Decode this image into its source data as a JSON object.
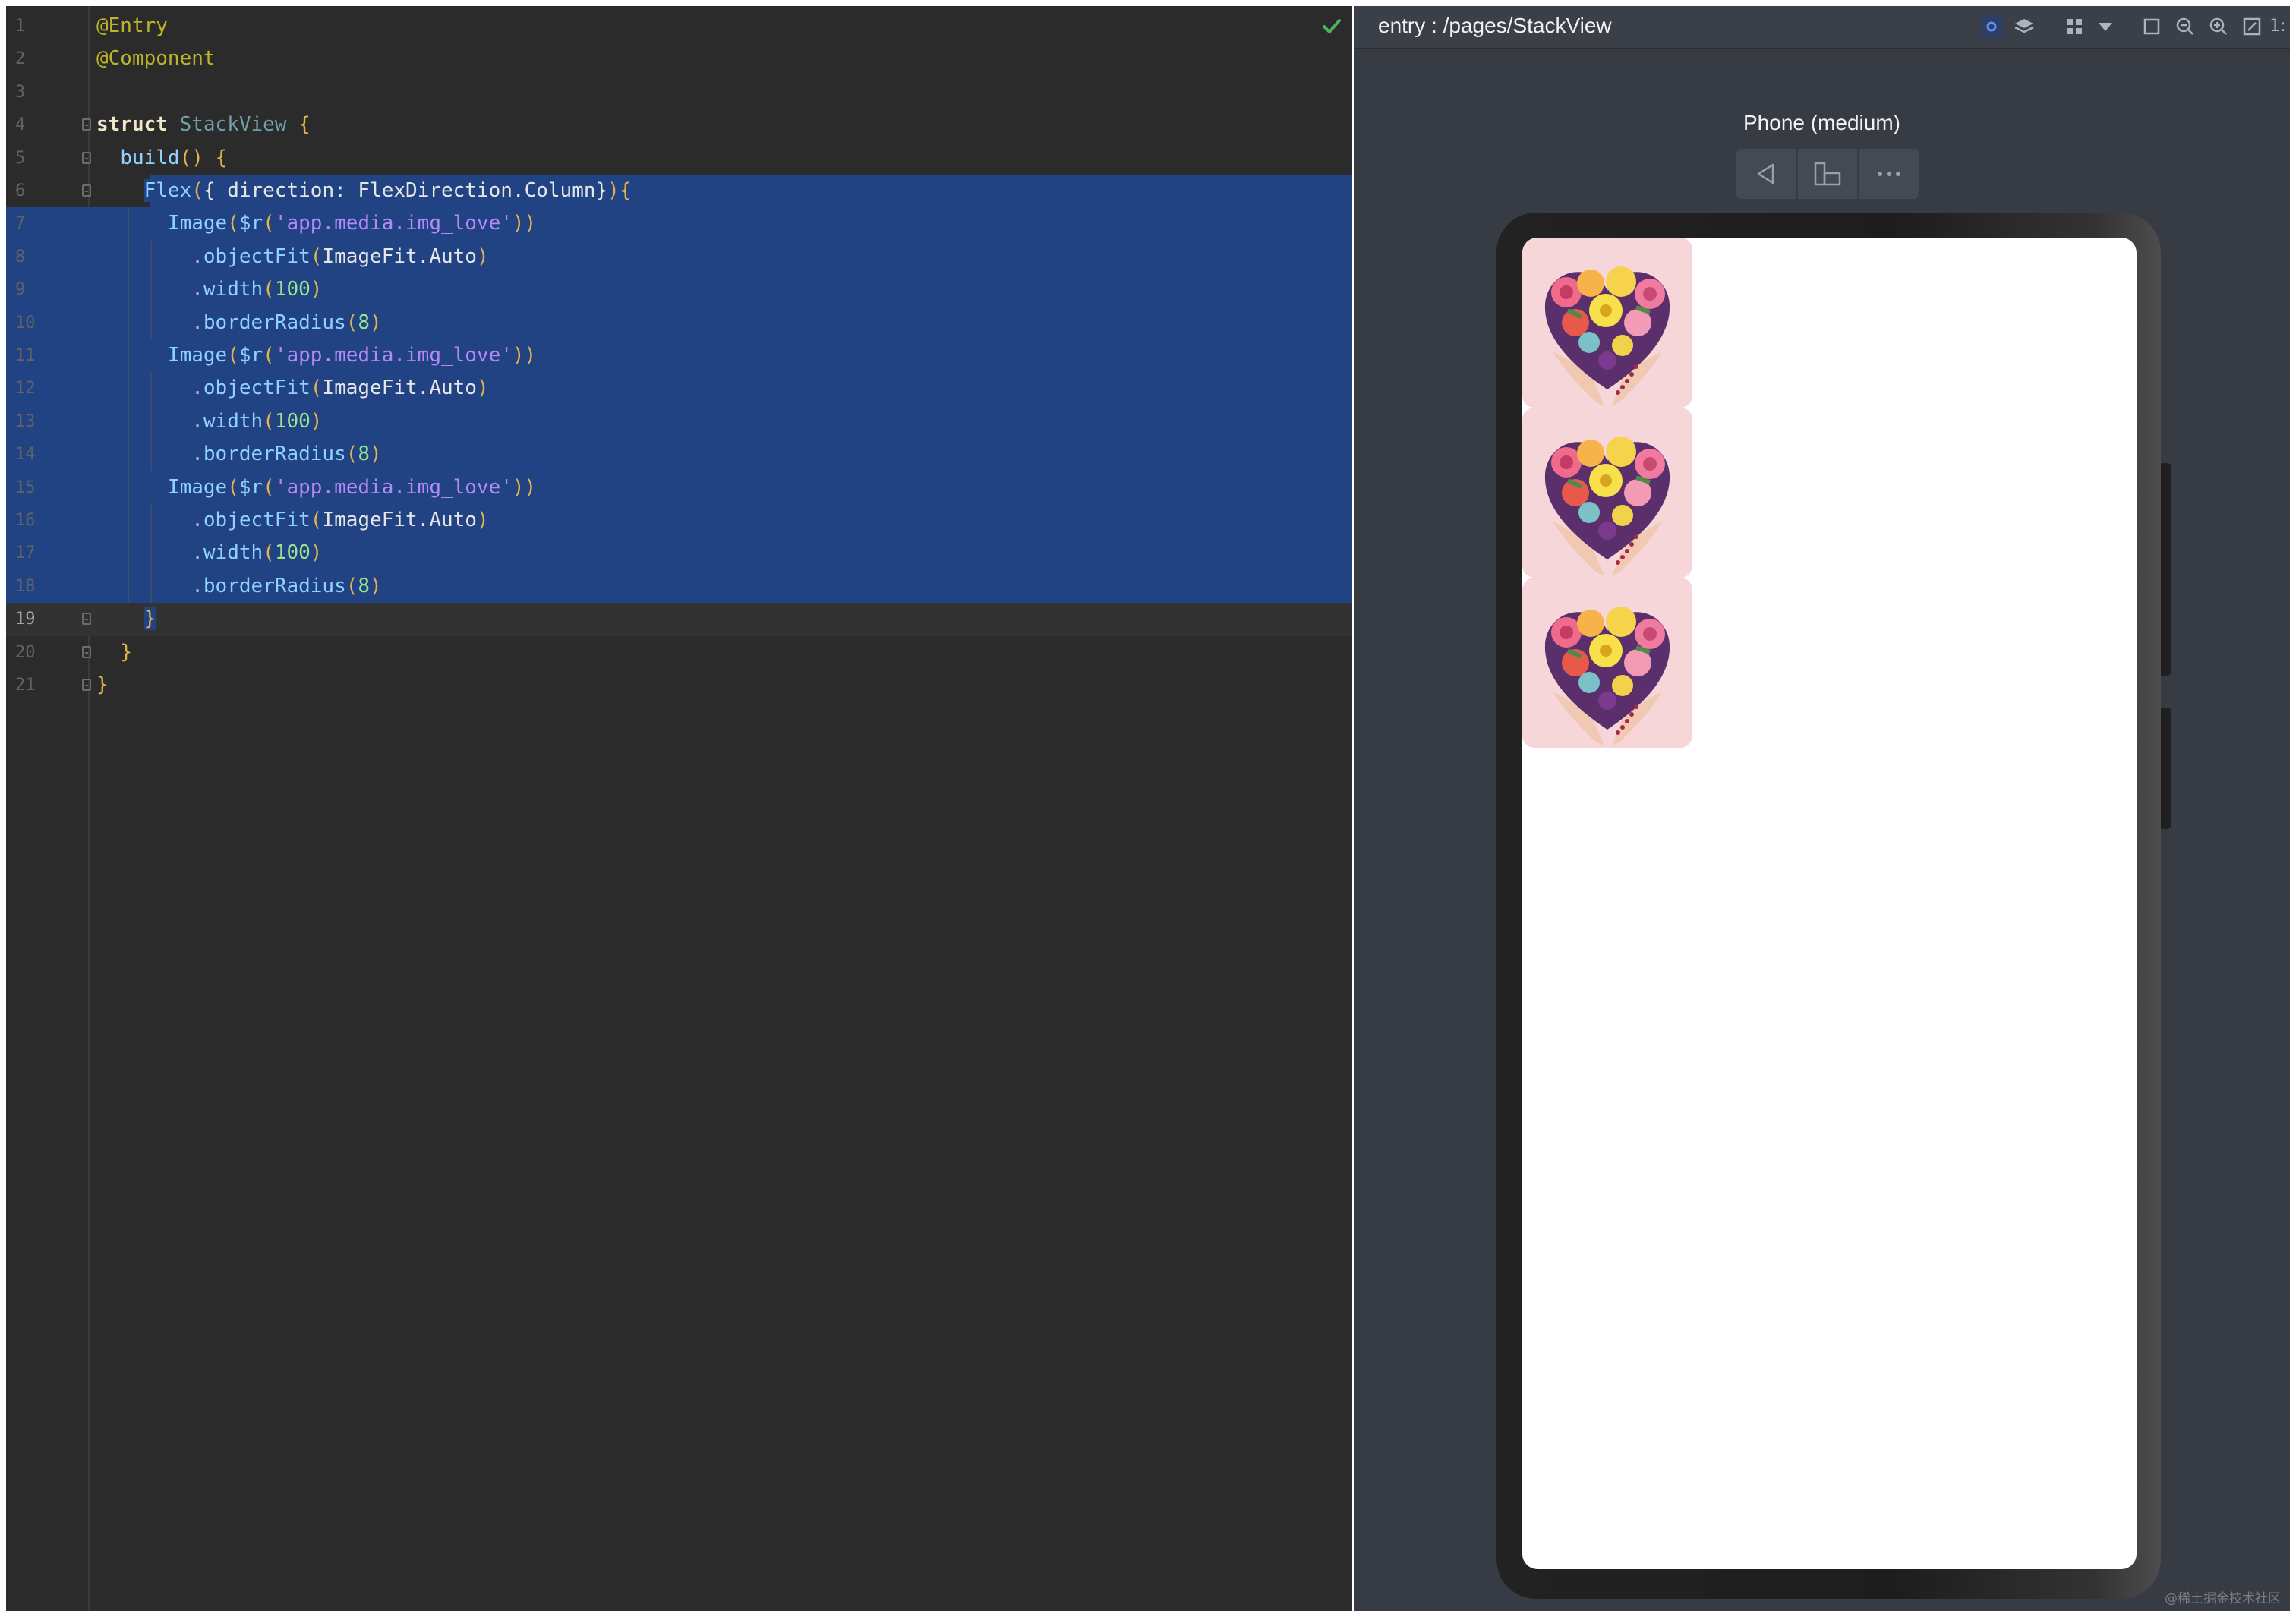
{
  "editor": {
    "lines": [
      {
        "no": "1",
        "html": [
          [
            "anno",
            "@Entry"
          ]
        ]
      },
      {
        "no": "2",
        "html": [
          [
            "anno",
            "@Component"
          ]
        ]
      },
      {
        "no": "3",
        "html": []
      },
      {
        "no": "4",
        "html": [
          [
            "kw",
            "struct"
          ],
          [
            "plain",
            " "
          ],
          [
            "type",
            "StackView"
          ],
          [
            "plain",
            " "
          ],
          [
            "brace",
            "{"
          ]
        ]
      },
      {
        "no": "5",
        "html": [
          [
            "plain",
            "  "
          ],
          [
            "fn",
            "build"
          ],
          [
            "brace",
            "()"
          ],
          [
            "plain",
            " "
          ],
          [
            "brace",
            "{"
          ]
        ]
      },
      {
        "no": "6",
        "html": [
          [
            "plain",
            "    "
          ],
          [
            "fn",
            "Flex"
          ],
          [
            "brace",
            "("
          ],
          [
            "punc",
            "{ "
          ],
          [
            "id",
            "direction"
          ],
          [
            "punc",
            ": "
          ],
          [
            "id",
            "FlexDirection"
          ],
          [
            "punc",
            "."
          ],
          [
            "id",
            "Column"
          ],
          [
            "punc",
            "}"
          ],
          [
            "brace",
            ")"
          ],
          [
            "brace",
            "{"
          ]
        ]
      },
      {
        "no": "7",
        "html": [
          [
            "plain",
            "      "
          ],
          [
            "fn",
            "Image"
          ],
          [
            "brace",
            "("
          ],
          [
            "fn",
            "$r"
          ],
          [
            "brace",
            "("
          ],
          [
            "str",
            "'app.media.img_love'"
          ],
          [
            "brace",
            "))"
          ]
        ]
      },
      {
        "no": "8",
        "html": [
          [
            "plain",
            "        ."
          ],
          [
            "fn",
            "objectFit"
          ],
          [
            "brace",
            "("
          ],
          [
            "id",
            "ImageFit"
          ],
          [
            "punc",
            "."
          ],
          [
            "id",
            "Auto"
          ],
          [
            "brace",
            ")"
          ]
        ]
      },
      {
        "no": "9",
        "html": [
          [
            "plain",
            "        ."
          ],
          [
            "fn",
            "width"
          ],
          [
            "brace",
            "("
          ],
          [
            "num",
            "100"
          ],
          [
            "brace",
            ")"
          ]
        ]
      },
      {
        "no": "10",
        "html": [
          [
            "plain",
            "        ."
          ],
          [
            "fn",
            "borderRadius"
          ],
          [
            "brace",
            "("
          ],
          [
            "num",
            "8"
          ],
          [
            "brace",
            ")"
          ]
        ]
      },
      {
        "no": "11",
        "html": [
          [
            "plain",
            "      "
          ],
          [
            "fn",
            "Image"
          ],
          [
            "brace",
            "("
          ],
          [
            "fn",
            "$r"
          ],
          [
            "brace",
            "("
          ],
          [
            "str",
            "'app.media.img_love'"
          ],
          [
            "brace",
            "))"
          ]
        ]
      },
      {
        "no": "12",
        "html": [
          [
            "plain",
            "        ."
          ],
          [
            "fn",
            "objectFit"
          ],
          [
            "brace",
            "("
          ],
          [
            "id",
            "ImageFit"
          ],
          [
            "punc",
            "."
          ],
          [
            "id",
            "Auto"
          ],
          [
            "brace",
            ")"
          ]
        ]
      },
      {
        "no": "13",
        "html": [
          [
            "plain",
            "        ."
          ],
          [
            "fn",
            "width"
          ],
          [
            "brace",
            "("
          ],
          [
            "num",
            "100"
          ],
          [
            "brace",
            ")"
          ]
        ]
      },
      {
        "no": "14",
        "html": [
          [
            "plain",
            "        ."
          ],
          [
            "fn",
            "borderRadius"
          ],
          [
            "brace",
            "("
          ],
          [
            "num",
            "8"
          ],
          [
            "brace",
            ")"
          ]
        ]
      },
      {
        "no": "15",
        "html": [
          [
            "plain",
            "      "
          ],
          [
            "fn",
            "Image"
          ],
          [
            "brace",
            "("
          ],
          [
            "fn",
            "$r"
          ],
          [
            "brace",
            "("
          ],
          [
            "str",
            "'app.media.img_love'"
          ],
          [
            "brace",
            "))"
          ]
        ]
      },
      {
        "no": "16",
        "html": [
          [
            "plain",
            "        ."
          ],
          [
            "fn",
            "objectFit"
          ],
          [
            "brace",
            "("
          ],
          [
            "id",
            "ImageFit"
          ],
          [
            "punc",
            "."
          ],
          [
            "id",
            "Auto"
          ],
          [
            "brace",
            ")"
          ]
        ]
      },
      {
        "no": "17",
        "html": [
          [
            "plain",
            "        ."
          ],
          [
            "fn",
            "width"
          ],
          [
            "brace",
            "("
          ],
          [
            "num",
            "100"
          ],
          [
            "brace",
            ")"
          ]
        ]
      },
      {
        "no": "18",
        "html": [
          [
            "plain",
            "        ."
          ],
          [
            "fn",
            "borderRadius"
          ],
          [
            "brace",
            "("
          ],
          [
            "num",
            "8"
          ],
          [
            "brace",
            ")"
          ]
        ]
      },
      {
        "no": "19",
        "html": [
          [
            "plain",
            "    "
          ],
          [
            "brace",
            "}"
          ]
        ]
      },
      {
        "no": "20",
        "html": [
          [
            "plain",
            "  "
          ],
          [
            "brace",
            "}"
          ]
        ]
      },
      {
        "no": "21",
        "html": [
          [
            "brace",
            "}"
          ]
        ]
      }
    ]
  },
  "preview": {
    "path": "entry : /pages/StackView",
    "device_label": "Phone (medium)",
    "toolbar_icons": [
      "eye-icon",
      "layers-icon",
      "grid-icon",
      "dropdown-icon",
      "crop-icon",
      "zoom-out-icon",
      "zoom-in-icon",
      "fit-icon",
      "ratio-icon"
    ],
    "ratio_label": "1:",
    "device_buttons": [
      "back-icon",
      "rotate-icon",
      "more-icon"
    ],
    "images": [
      {
        "alt": "img_love"
      },
      {
        "alt": "img_love"
      },
      {
        "alt": "img_love"
      }
    ]
  },
  "watermark": "@稀土掘金技术社区",
  "colors": {
    "editor_bg": "#2b2b2b",
    "selection": "#214283",
    "preview_bg": "#373b43",
    "accent": "#5a8dff"
  }
}
